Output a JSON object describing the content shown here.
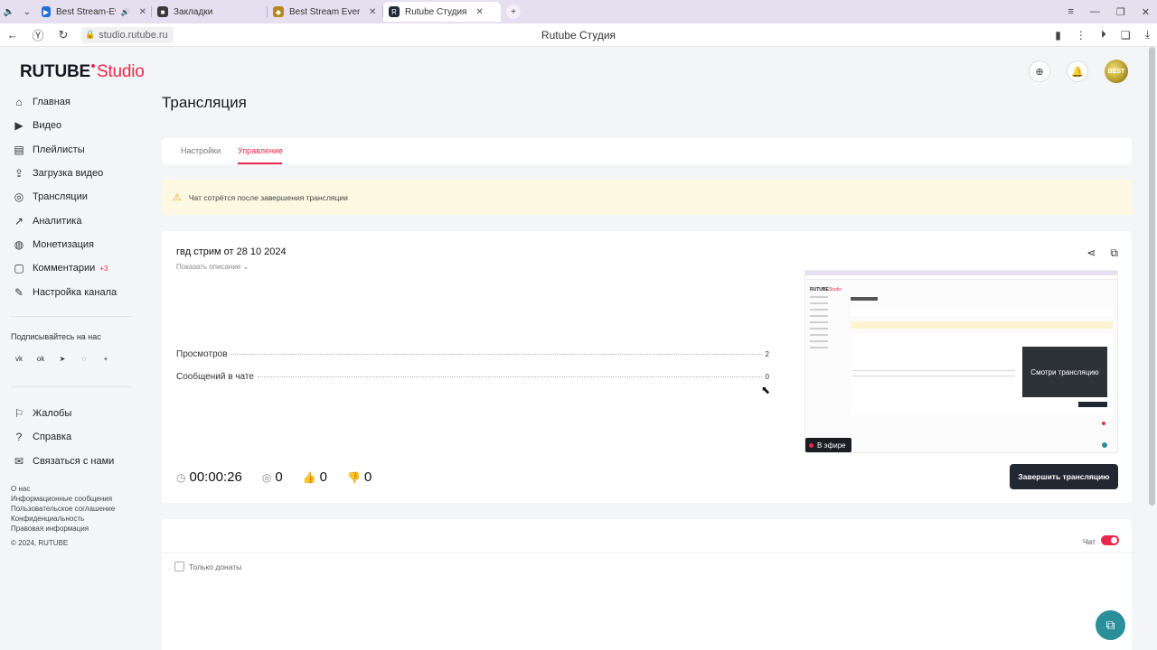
{
  "browser": {
    "tabs": [
      {
        "title": "Best Stream-Ever",
        "favicon_color": "#1e6fd9",
        "favicon_glyph": "▶",
        "audio": "🔊",
        "active": false
      },
      {
        "title": "Закладки",
        "favicon_color": "#3a3a3a",
        "favicon_glyph": "■",
        "active": false
      },
      {
        "title": "Best Stream Ever | Информ",
        "favicon_color": "#b58a1f",
        "favicon_glyph": "◆",
        "active": false
      },
      {
        "title": "Rutube Студия",
        "favicon_color": "#1f2a3a",
        "favicon_glyph": "R",
        "active": true
      }
    ],
    "url": "studio.rutube.ru",
    "page_title": "Rutube Студия"
  },
  "header": {
    "logo_brand": "RUTUBE",
    "logo_product": "Studio"
  },
  "sidebar": {
    "items": [
      {
        "label": "Главная",
        "icon": "home-icon",
        "glyph": "⌂"
      },
      {
        "label": "Видео",
        "icon": "video-icon",
        "glyph": "▶"
      },
      {
        "label": "Плейлисты",
        "icon": "playlist-icon",
        "glyph": "▤"
      },
      {
        "label": "Загрузка видео",
        "icon": "upload-icon",
        "glyph": "⇪"
      },
      {
        "label": "Трансляции",
        "icon": "broadcast-icon",
        "glyph": "◎"
      },
      {
        "label": "Аналитика",
        "icon": "analytics-icon",
        "glyph": "↗"
      },
      {
        "label": "Монетизация",
        "icon": "money-icon",
        "glyph": "◍"
      },
      {
        "label": "Комментарии",
        "icon": "comments-icon",
        "glyph": "▢",
        "badge": "+3"
      },
      {
        "label": "Настройка канала",
        "icon": "wand-icon",
        "glyph": "✎"
      }
    ],
    "subscribe_label": "Подписывайтесь на нас",
    "social": [
      {
        "name": "vk-icon",
        "glyph": "vk"
      },
      {
        "name": "ok-icon",
        "glyph": "ok"
      },
      {
        "name": "telegram-icon",
        "glyph": "➤"
      },
      {
        "name": "viber-icon",
        "glyph": "◌"
      },
      {
        "name": "plus-icon",
        "glyph": "+"
      }
    ],
    "lower_items": [
      {
        "label": "Жалобы",
        "icon": "flag-icon",
        "glyph": "⚐"
      },
      {
        "label": "Справка",
        "icon": "help-icon",
        "glyph": "?"
      },
      {
        "label": "Связаться с нами",
        "icon": "chat-icon",
        "glyph": "✉"
      }
    ],
    "footer": [
      "О нас",
      "Информационные сообщения",
      "Пользовательское соглашение",
      "Конфиденциальность",
      "Правовая информация",
      "© 2024, RUTUBE"
    ]
  },
  "main": {
    "heading": "Трансляция",
    "tabs": [
      {
        "label": "Настройки",
        "active": false
      },
      {
        "label": "Управление",
        "active": true
      }
    ],
    "warning": "Чат сотрётся после завершения трансляции",
    "stream": {
      "title": "гвд стрим от 28 10 2024",
      "show_description": "Показать описание",
      "stats": [
        {
          "label": "Просмотров",
          "value": "2"
        },
        {
          "label": "Сообщений в чате",
          "value": "0"
        }
      ],
      "duration": "00:00:26",
      "viewers": "0",
      "likes": "0",
      "dislikes": "0",
      "end_button": "Завершить трансляцию",
      "live_badge": "В эфире",
      "preview_overlay": "Смотри трансляцию"
    },
    "chat": {
      "label": "Чат",
      "only_donations": "Только донаты"
    }
  }
}
